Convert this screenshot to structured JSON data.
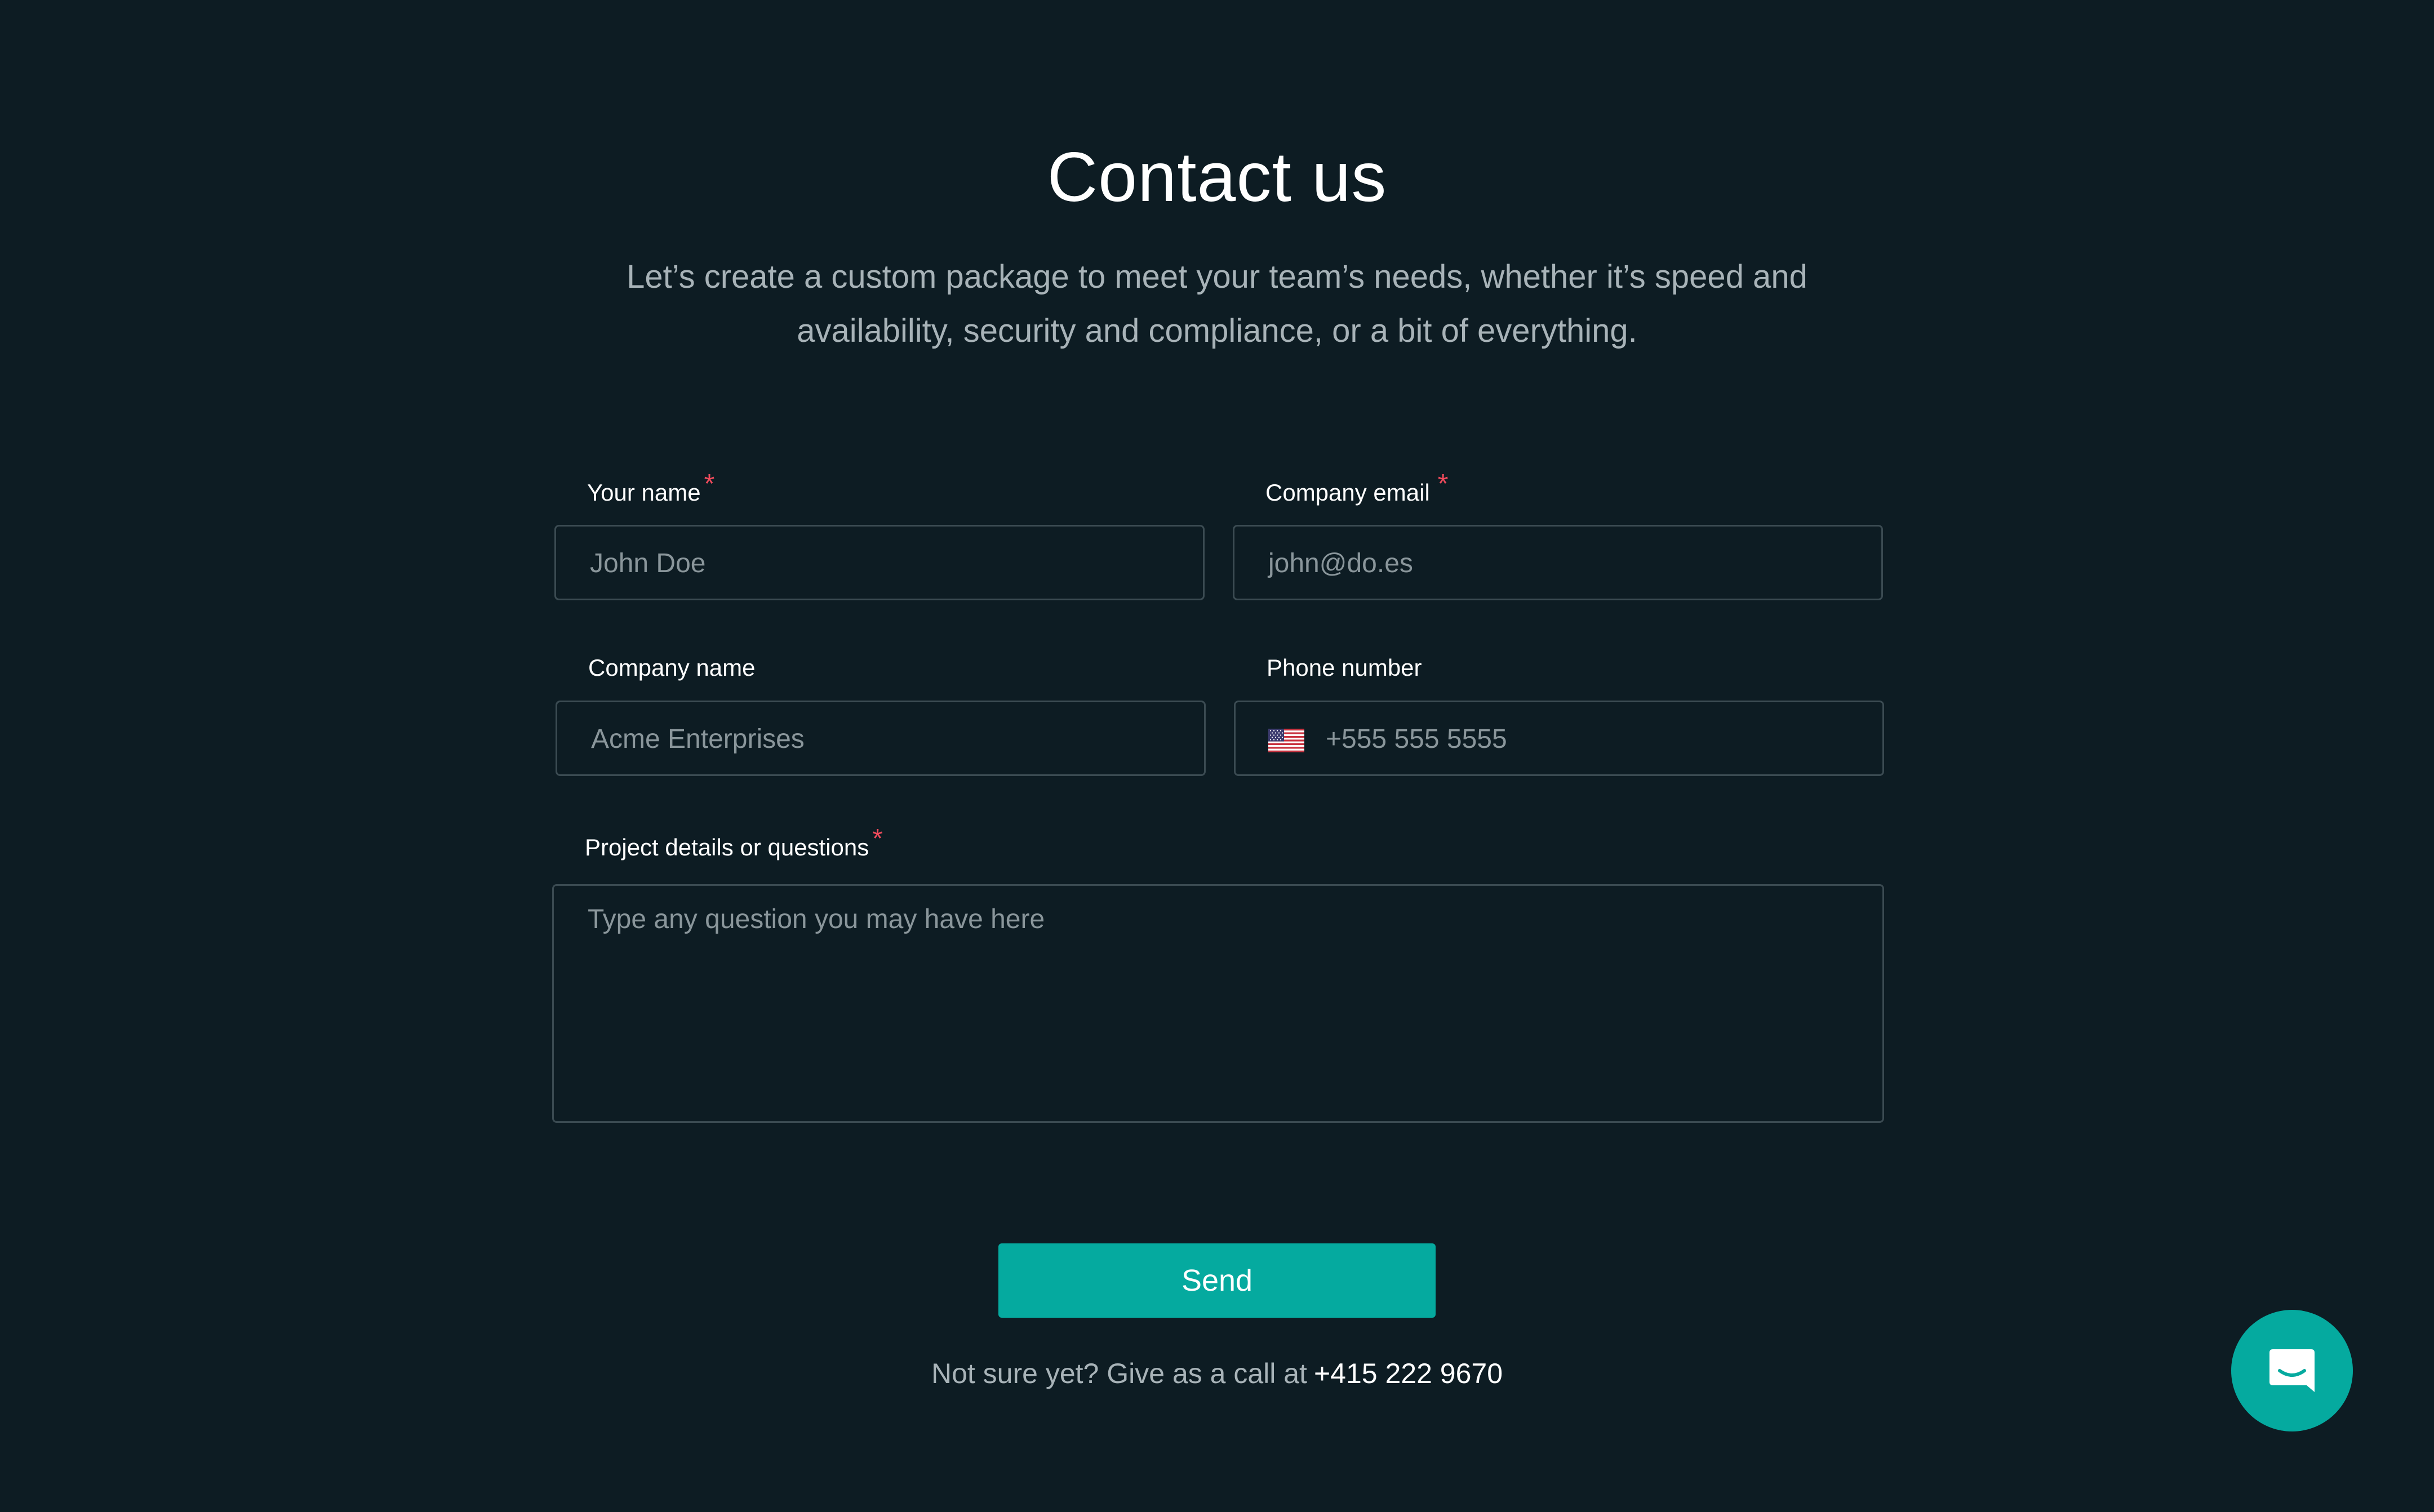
{
  "header": {
    "title": "Contact us",
    "subtitle": "Let’s create a custom package to meet your team’s needs, whether it’s speed and availability, security and compliance, or a bit of everything."
  },
  "form": {
    "name": {
      "label": "Your name",
      "required_marker": "*",
      "placeholder": "John Doe"
    },
    "email": {
      "label": "Company email",
      "required_marker": "*",
      "placeholder": "john@do.es"
    },
    "company": {
      "label": "Company name",
      "placeholder": "Acme Enterprises"
    },
    "phone": {
      "label": "Phone number",
      "country_icon": "us-flag-icon",
      "placeholder": "+555 555 5555"
    },
    "details": {
      "label": "Project details or questions",
      "required_marker": "*",
      "placeholder": "Type any question you may have here"
    },
    "send_label": "Send"
  },
  "footer": {
    "callout_text": "Not sure yet? Give as a call at",
    "phone": "+415 222 9670"
  },
  "chat_widget": {
    "icon": "chat-bubble-icon"
  },
  "colors": {
    "background": "#0d1c23",
    "accent": "#05aa9f",
    "required": "#f04b5c",
    "muted_text": "#a8b3b8",
    "input_border": "#3b4b52"
  }
}
